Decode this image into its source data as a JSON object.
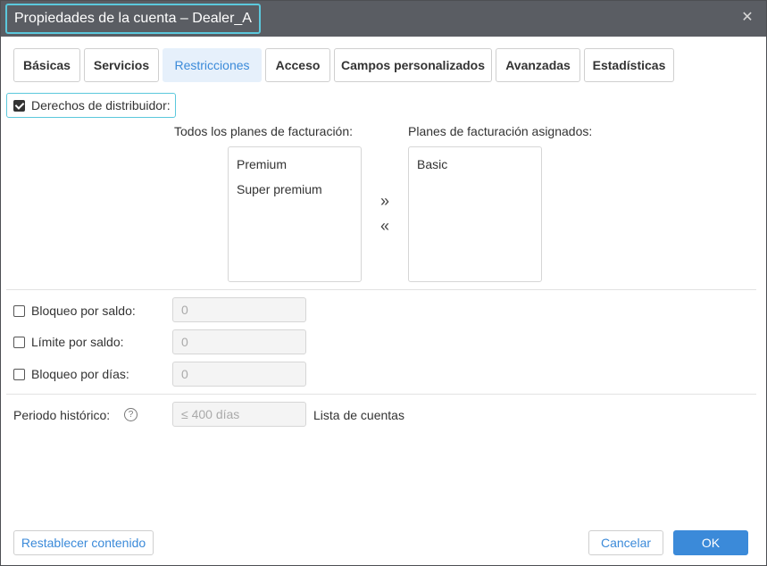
{
  "window": {
    "title": "Propiedades de la cuenta – Dealer_A"
  },
  "tabs": [
    {
      "label": "Básicas",
      "active": false
    },
    {
      "label": "Servicios",
      "active": false
    },
    {
      "label": "Restricciones",
      "active": true
    },
    {
      "label": "Acceso",
      "active": false
    },
    {
      "label": "Campos personalizados",
      "active": false
    },
    {
      "label": "Avanzadas",
      "active": false
    },
    {
      "label": "Estadísticas",
      "active": false
    }
  ],
  "dealer_rights": {
    "label": "Derechos de distribuidor:",
    "checked": true
  },
  "billing": {
    "all_plans_label": "Todos los planes de facturación:",
    "assigned_plans_label": "Planes de facturación asignados:",
    "all_plans": [
      "Premium",
      "Super premium"
    ],
    "assigned_plans": [
      "Basic"
    ],
    "move_right_glyph": "»",
    "move_left_glyph": "«"
  },
  "restrictions": [
    {
      "label": "Bloqueo por saldo:",
      "checked": false,
      "value": "0"
    },
    {
      "label": "Límite por saldo:",
      "checked": false,
      "value": "0"
    },
    {
      "label": "Bloqueo por días:",
      "checked": false,
      "value": "0"
    }
  ],
  "history": {
    "label": "Periodo histórico:",
    "help_glyph": "?",
    "placeholder": "≤ 400 días",
    "suffix": "Lista de cuentas"
  },
  "footer": {
    "reset_label": "Restablecer contenido",
    "cancel_label": "Cancelar",
    "ok_label": "OK"
  },
  "colors": {
    "titlebar": "#5a5d63",
    "accent": "#3b8ad9",
    "focus_outline": "#5bc8dc",
    "active_tab_bg": "#e6f0fb"
  }
}
